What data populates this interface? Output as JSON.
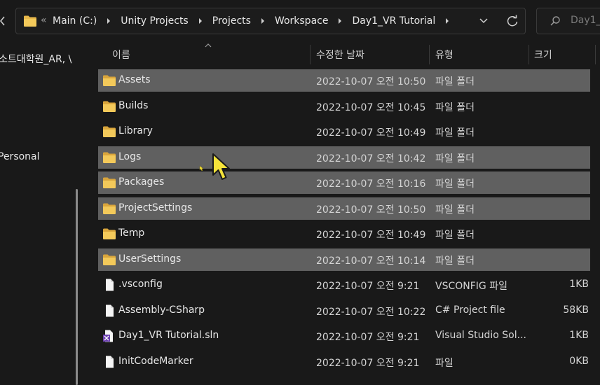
{
  "address_bar": {
    "overflow": "«",
    "crumbs": [
      "Main (C:)",
      "Unity Projects",
      "Projects",
      "Workspace",
      "Day1_VR Tutorial"
    ]
  },
  "search": {
    "placeholder": "Day1_"
  },
  "sidebar": {
    "items": [
      "소트대학원_AR, \\",
      "Personal"
    ]
  },
  "columns": {
    "name": "이름",
    "date": "수정한 날짜",
    "type": "유형",
    "size": "크기"
  },
  "files": [
    {
      "name": "Assets",
      "date": "2022-10-07 오전 10:50",
      "type": "파일 폴더",
      "size": "",
      "icon": "folder-icon",
      "selected": true
    },
    {
      "name": "Builds",
      "date": "2022-10-07 오전 10:45",
      "type": "파일 폴더",
      "size": "",
      "icon": "folder-icon",
      "selected": false
    },
    {
      "name": "Library",
      "date": "2022-10-07 오전 10:49",
      "type": "파일 폴더",
      "size": "",
      "icon": "folder-icon",
      "selected": false
    },
    {
      "name": "Logs",
      "date": "2022-10-07 오전 10:42",
      "type": "파일 폴더",
      "size": "",
      "icon": "folder-icon",
      "selected": true
    },
    {
      "name": "Packages",
      "date": "2022-10-07 오전 10:16",
      "type": "파일 폴더",
      "size": "",
      "icon": "folder-icon",
      "selected": true
    },
    {
      "name": "ProjectSettings",
      "date": "2022-10-07 오전 10:50",
      "type": "파일 폴더",
      "size": "",
      "icon": "folder-icon",
      "selected": true
    },
    {
      "name": "Temp",
      "date": "2022-10-07 오전 10:49",
      "type": "파일 폴더",
      "size": "",
      "icon": "folder-icon",
      "selected": false
    },
    {
      "name": "UserSettings",
      "date": "2022-10-07 오전 10:14",
      "type": "파일 폴더",
      "size": "",
      "icon": "folder-icon",
      "selected": true
    },
    {
      "name": ".vsconfig",
      "date": "2022-10-07 오전 9:21",
      "type": "VSCONFIG 파일",
      "size": "1KB",
      "icon": "file-icon",
      "selected": false
    },
    {
      "name": "Assembly-CSharp",
      "date": "2022-10-07 오전 10:22",
      "type": "C# Project file",
      "size": "58KB",
      "icon": "file-icon",
      "selected": false
    },
    {
      "name": "Day1_VR Tutorial.sln",
      "date": "2022-10-07 오전 9:21",
      "type": "Visual Studio Sol...",
      "size": "1KB",
      "icon": "visual-studio-solution-icon",
      "selected": false
    },
    {
      "name": "InitCodeMarker",
      "date": "2022-10-07 오전 9:21",
      "type": "파일",
      "size": "0KB",
      "icon": "file-icon",
      "selected": false
    }
  ],
  "colors": {
    "background": "#191919",
    "selected_row": "#606060",
    "folder": "#e8b84a",
    "cursor": "#f5e33a"
  }
}
